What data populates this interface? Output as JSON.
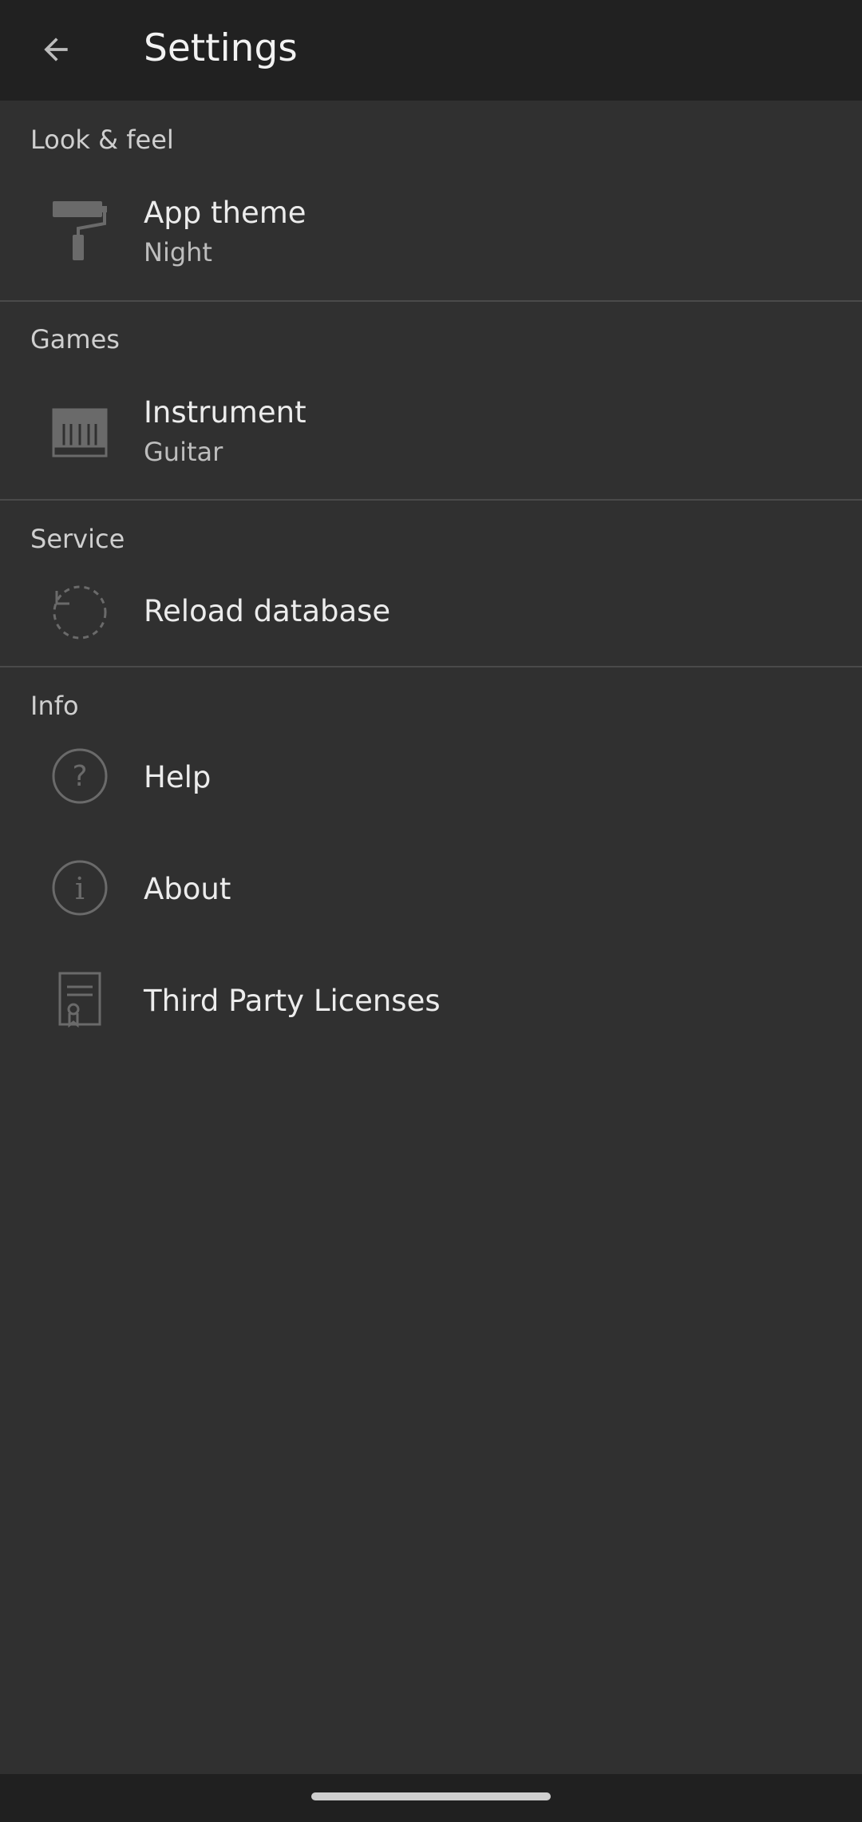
{
  "appbar": {
    "title": "Settings",
    "back_icon": "arrow-left-icon"
  },
  "sections": [
    {
      "header": "Look & feel",
      "items": [
        {
          "title": "App theme",
          "subtitle": "Night",
          "icon": "paint-roller-icon"
        }
      ]
    },
    {
      "header": "Games",
      "items": [
        {
          "title": "Instrument",
          "subtitle": "Guitar",
          "icon": "piano-keyboard-icon"
        }
      ]
    },
    {
      "header": "Service",
      "items": [
        {
          "title": "Reload database",
          "icon": "reload-icon"
        }
      ]
    },
    {
      "header": "Info",
      "items": [
        {
          "title": "Help",
          "icon": "help-circle-icon"
        },
        {
          "title": "About",
          "icon": "info-circle-icon"
        },
        {
          "title": "Third Party Licenses",
          "icon": "certificate-icon"
        }
      ]
    }
  ],
  "colors": {
    "appbar_bg": "#212121",
    "page_bg": "#303030",
    "icon": "#8a8a8a",
    "divider": "#4a4a4a"
  }
}
